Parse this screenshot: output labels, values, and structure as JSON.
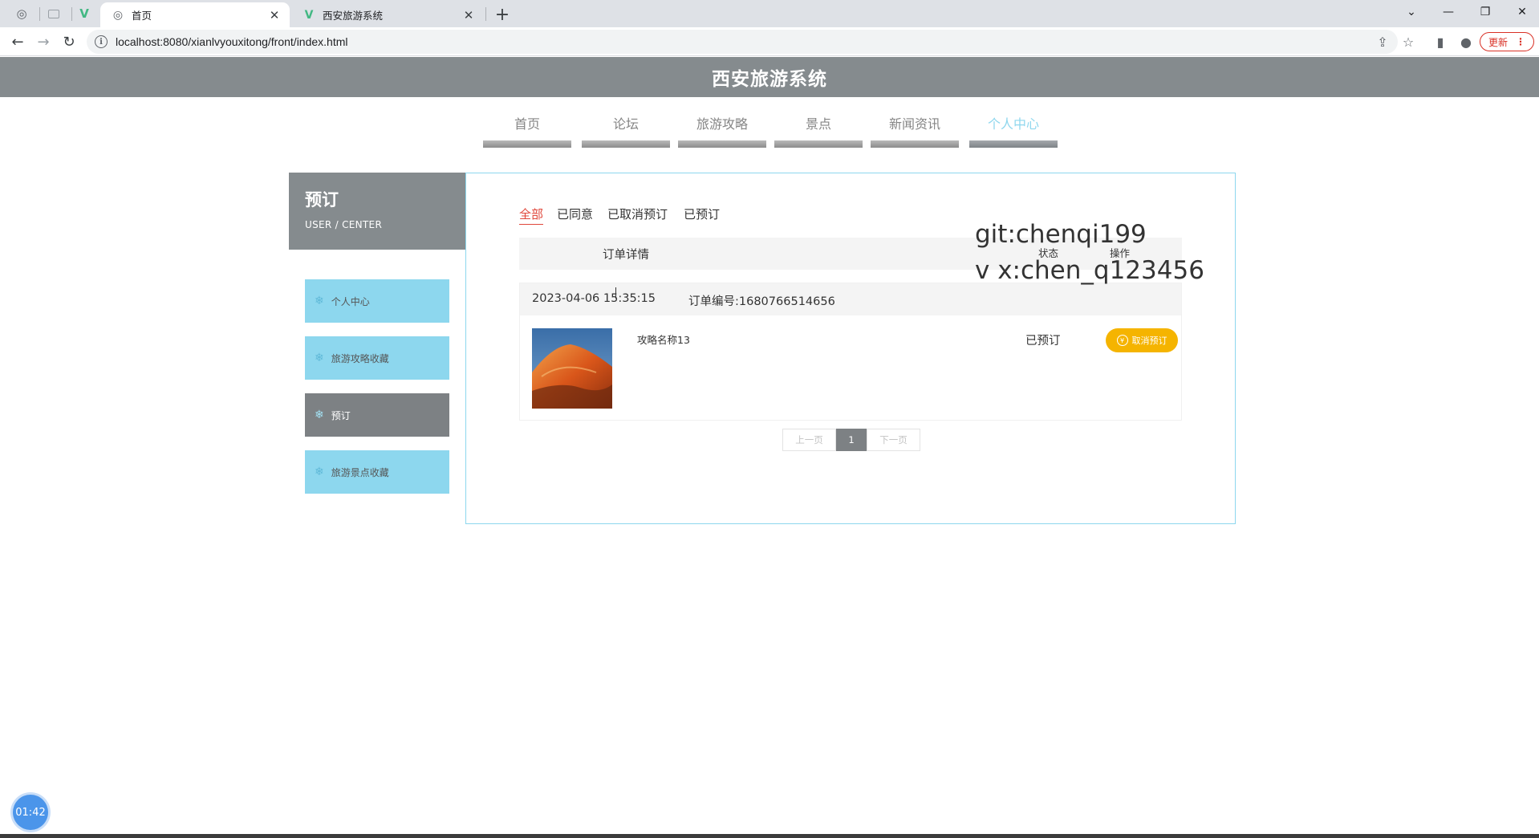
{
  "browser": {
    "tabs": [
      {
        "title": "首页",
        "active": true,
        "favicon": "globe-icon"
      },
      {
        "title": "西安旅游系统",
        "active": false,
        "favicon": "vue-logo-icon"
      }
    ],
    "url": "localhost:8080/xianlvyouxitong/front/index.html",
    "update_label": "更新"
  },
  "site": {
    "title": "西安旅游系统",
    "nav": [
      "首页",
      "论坛",
      "旅游攻略",
      "景点",
      "新闻资讯",
      "个人中心"
    ],
    "current_nav": "个人中心"
  },
  "sidebar": {
    "title": "预订",
    "subtitle": "USER / CENTER",
    "items": [
      {
        "label": "个人中心",
        "active": false
      },
      {
        "label": "旅游攻略收藏",
        "active": false
      },
      {
        "label": "预订",
        "active": true
      },
      {
        "label": "旅游景点收藏",
        "active": false
      }
    ]
  },
  "orders": {
    "filters": [
      "全部",
      "已同意",
      "已取消预订",
      "已预订"
    ],
    "current_filter": "全部",
    "columns": {
      "detail": "订单详情",
      "status": "状态",
      "action": "操作"
    },
    "items": [
      {
        "date": "2023-04-06 15:35:15",
        "order_no": "订单编号:1680766514656",
        "name": "攻略名称13",
        "status": "已预订",
        "action": "取消预订"
      }
    ],
    "pager": {
      "prev": "上一页",
      "page": "1",
      "next": "下一页"
    }
  },
  "overlay": {
    "watermark_line1": "git:chenqi199",
    "watermark_line2": "v x:chen_q123456",
    "timer": "01:42"
  },
  "colors": {
    "header_gray": "#858b8e",
    "accent_cyan": "#8dd7ee",
    "active_gray": "#7d8184",
    "filter_red": "#e0473b",
    "button_yellow": "#f5b400"
  }
}
